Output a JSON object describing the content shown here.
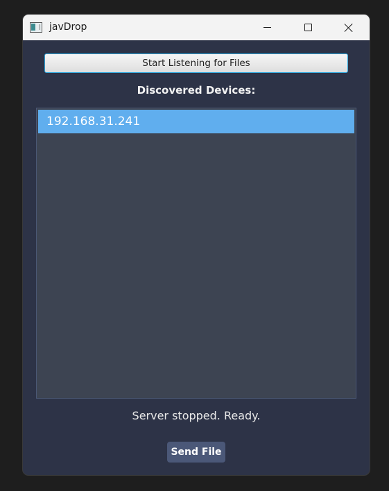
{
  "window": {
    "title": "javDrop",
    "controls": {
      "minimize_icon": "minimize-icon",
      "maximize_icon": "maximize-icon",
      "close_icon": "close-icon"
    }
  },
  "actions": {
    "listen_label": "Start Listening for Files",
    "send_label": "Send File"
  },
  "devices": {
    "heading": "Discovered Devices:",
    "items": [
      {
        "label": "192.168.31.241",
        "selected": true
      }
    ]
  },
  "status": {
    "text": "Server stopped. Ready."
  },
  "colors": {
    "background": "#2d3347",
    "list_background": "#3d4452",
    "selection": "#60aeee",
    "listen_button_focus": "#2ea8df",
    "send_button": "#4b5878"
  }
}
